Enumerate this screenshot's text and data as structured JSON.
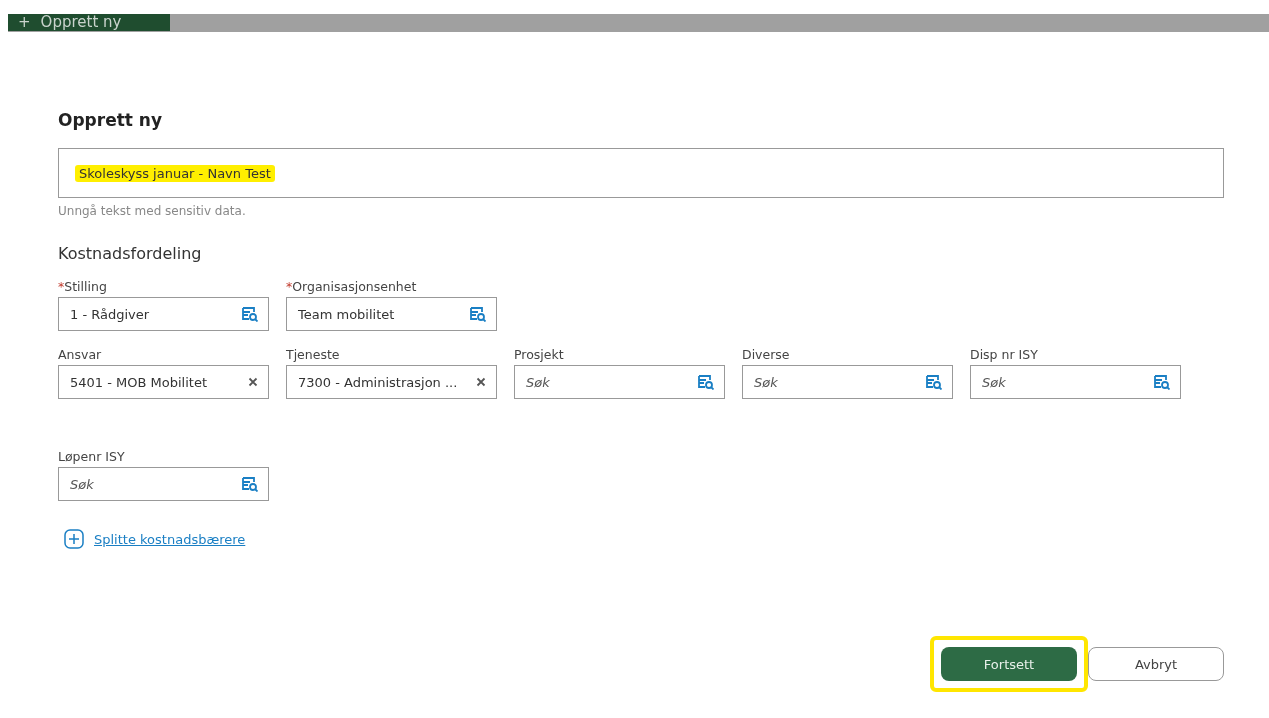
{
  "background_tab": {
    "icon": "+",
    "label": "Opprett ny"
  },
  "dialog": {
    "title": "Opprett ny",
    "name_field": {
      "value": "Skoleskyss januar - Navn Test",
      "highlighted": true
    },
    "hint": "Unngå tekst med sensitiv data.",
    "section_title": "Kostnadsfordeling",
    "field_rows": [
      [
        {
          "required_mark": "*",
          "label": "Stilling",
          "value": "1 - Rådgiver",
          "kind": "search"
        },
        {
          "required_mark": "*",
          "label": "Organisasjonsenhet",
          "value": "Team mobilitet",
          "kind": "search"
        }
      ],
      [
        {
          "label": "Ansvar",
          "value": "5401 - MOB Mobilitet",
          "kind": "clear"
        },
        {
          "label": "Tjeneste",
          "value": "7300 - Administrasjon ...",
          "kind": "clear"
        },
        {
          "label": "Prosjekt",
          "placeholder": "Søk",
          "kind": "search"
        },
        {
          "label": "Diverse",
          "placeholder": "Søk",
          "kind": "search"
        },
        {
          "label": "Disp nr ISY",
          "placeholder": "Søk",
          "kind": "search"
        }
      ],
      [
        {
          "label": "Løpenr ISY",
          "placeholder": "Søk",
          "kind": "search"
        }
      ]
    ],
    "split_link": "Splitte kostnadsbærere",
    "buttons": [
      {
        "label": "Fortsett",
        "kind": "primary",
        "highlighted": true
      },
      {
        "label": "Avbryt",
        "kind": "secondary",
        "highlighted": false
      }
    ]
  }
}
